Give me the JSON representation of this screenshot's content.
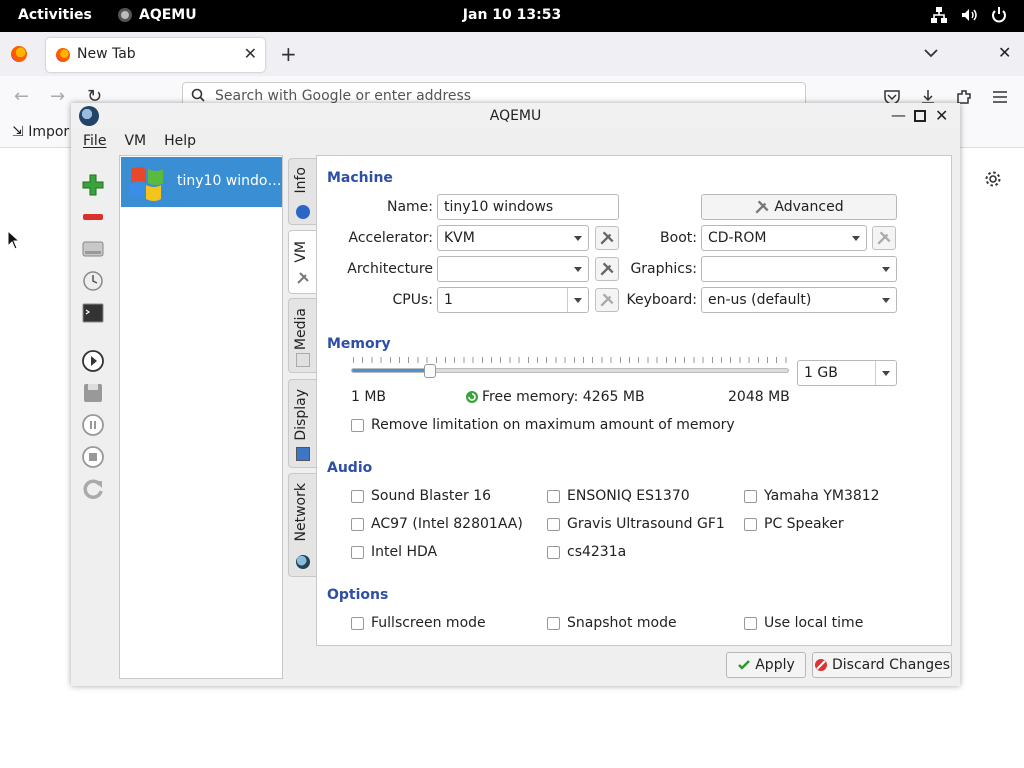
{
  "topbar": {
    "activities": "Activities",
    "app_name": "AQEMU",
    "clock": "Jan 10  13:53"
  },
  "firefox": {
    "tab_title": "New Tab",
    "url_placeholder": "Search with Google or enter address",
    "import_label": "Impor"
  },
  "window": {
    "title": "AQEMU",
    "menu": [
      "File",
      "VM",
      "Help"
    ]
  },
  "vm_list": [
    {
      "name": "tiny10 windo…",
      "selected": true
    }
  ],
  "tabs": [
    "Info",
    "VM",
    "Media",
    "Display",
    "Network"
  ],
  "machine": {
    "section": "Machine",
    "name_label": "Name:",
    "name_value": "tiny10 windows",
    "advanced_label": "Advanced",
    "accelerator_label": "Accelerator:",
    "accelerator_value": "KVM",
    "boot_label": "Boot:",
    "boot_value": "CD-ROM",
    "architecture_label": "Architecture",
    "architecture_value": "",
    "graphics_label": "Graphics:",
    "graphics_value": "",
    "cpus_label": "CPUs:",
    "cpus_value": "1",
    "keyboard_label": "Keyboard:",
    "keyboard_value": "en-us (default)"
  },
  "memory": {
    "section": "Memory",
    "min_label": "1 MB",
    "max_label": "2048 MB",
    "free_label": "Free memory: 4265 MB",
    "value_label": "1 GB",
    "slider_fraction": 0.18,
    "remove_limit_label": "Remove limitation on maximum amount of memory"
  },
  "audio": {
    "section": "Audio",
    "cards": [
      "Sound Blaster 16",
      "ENSONIQ ES1370",
      "Yamaha YM3812",
      "AC97 (Intel 82801AA)",
      "Gravis Ultrasound GF1",
      "PC Speaker",
      "Intel HDA",
      "cs4231a"
    ]
  },
  "options": {
    "section": "Options",
    "items": [
      "Fullscreen mode",
      "Snapshot mode",
      "Use local time"
    ]
  },
  "buttons": {
    "apply": "Apply",
    "discard": "Discard Changes"
  },
  "colors": {
    "accent": "#3a8fd4",
    "section": "#2d4fa8"
  }
}
